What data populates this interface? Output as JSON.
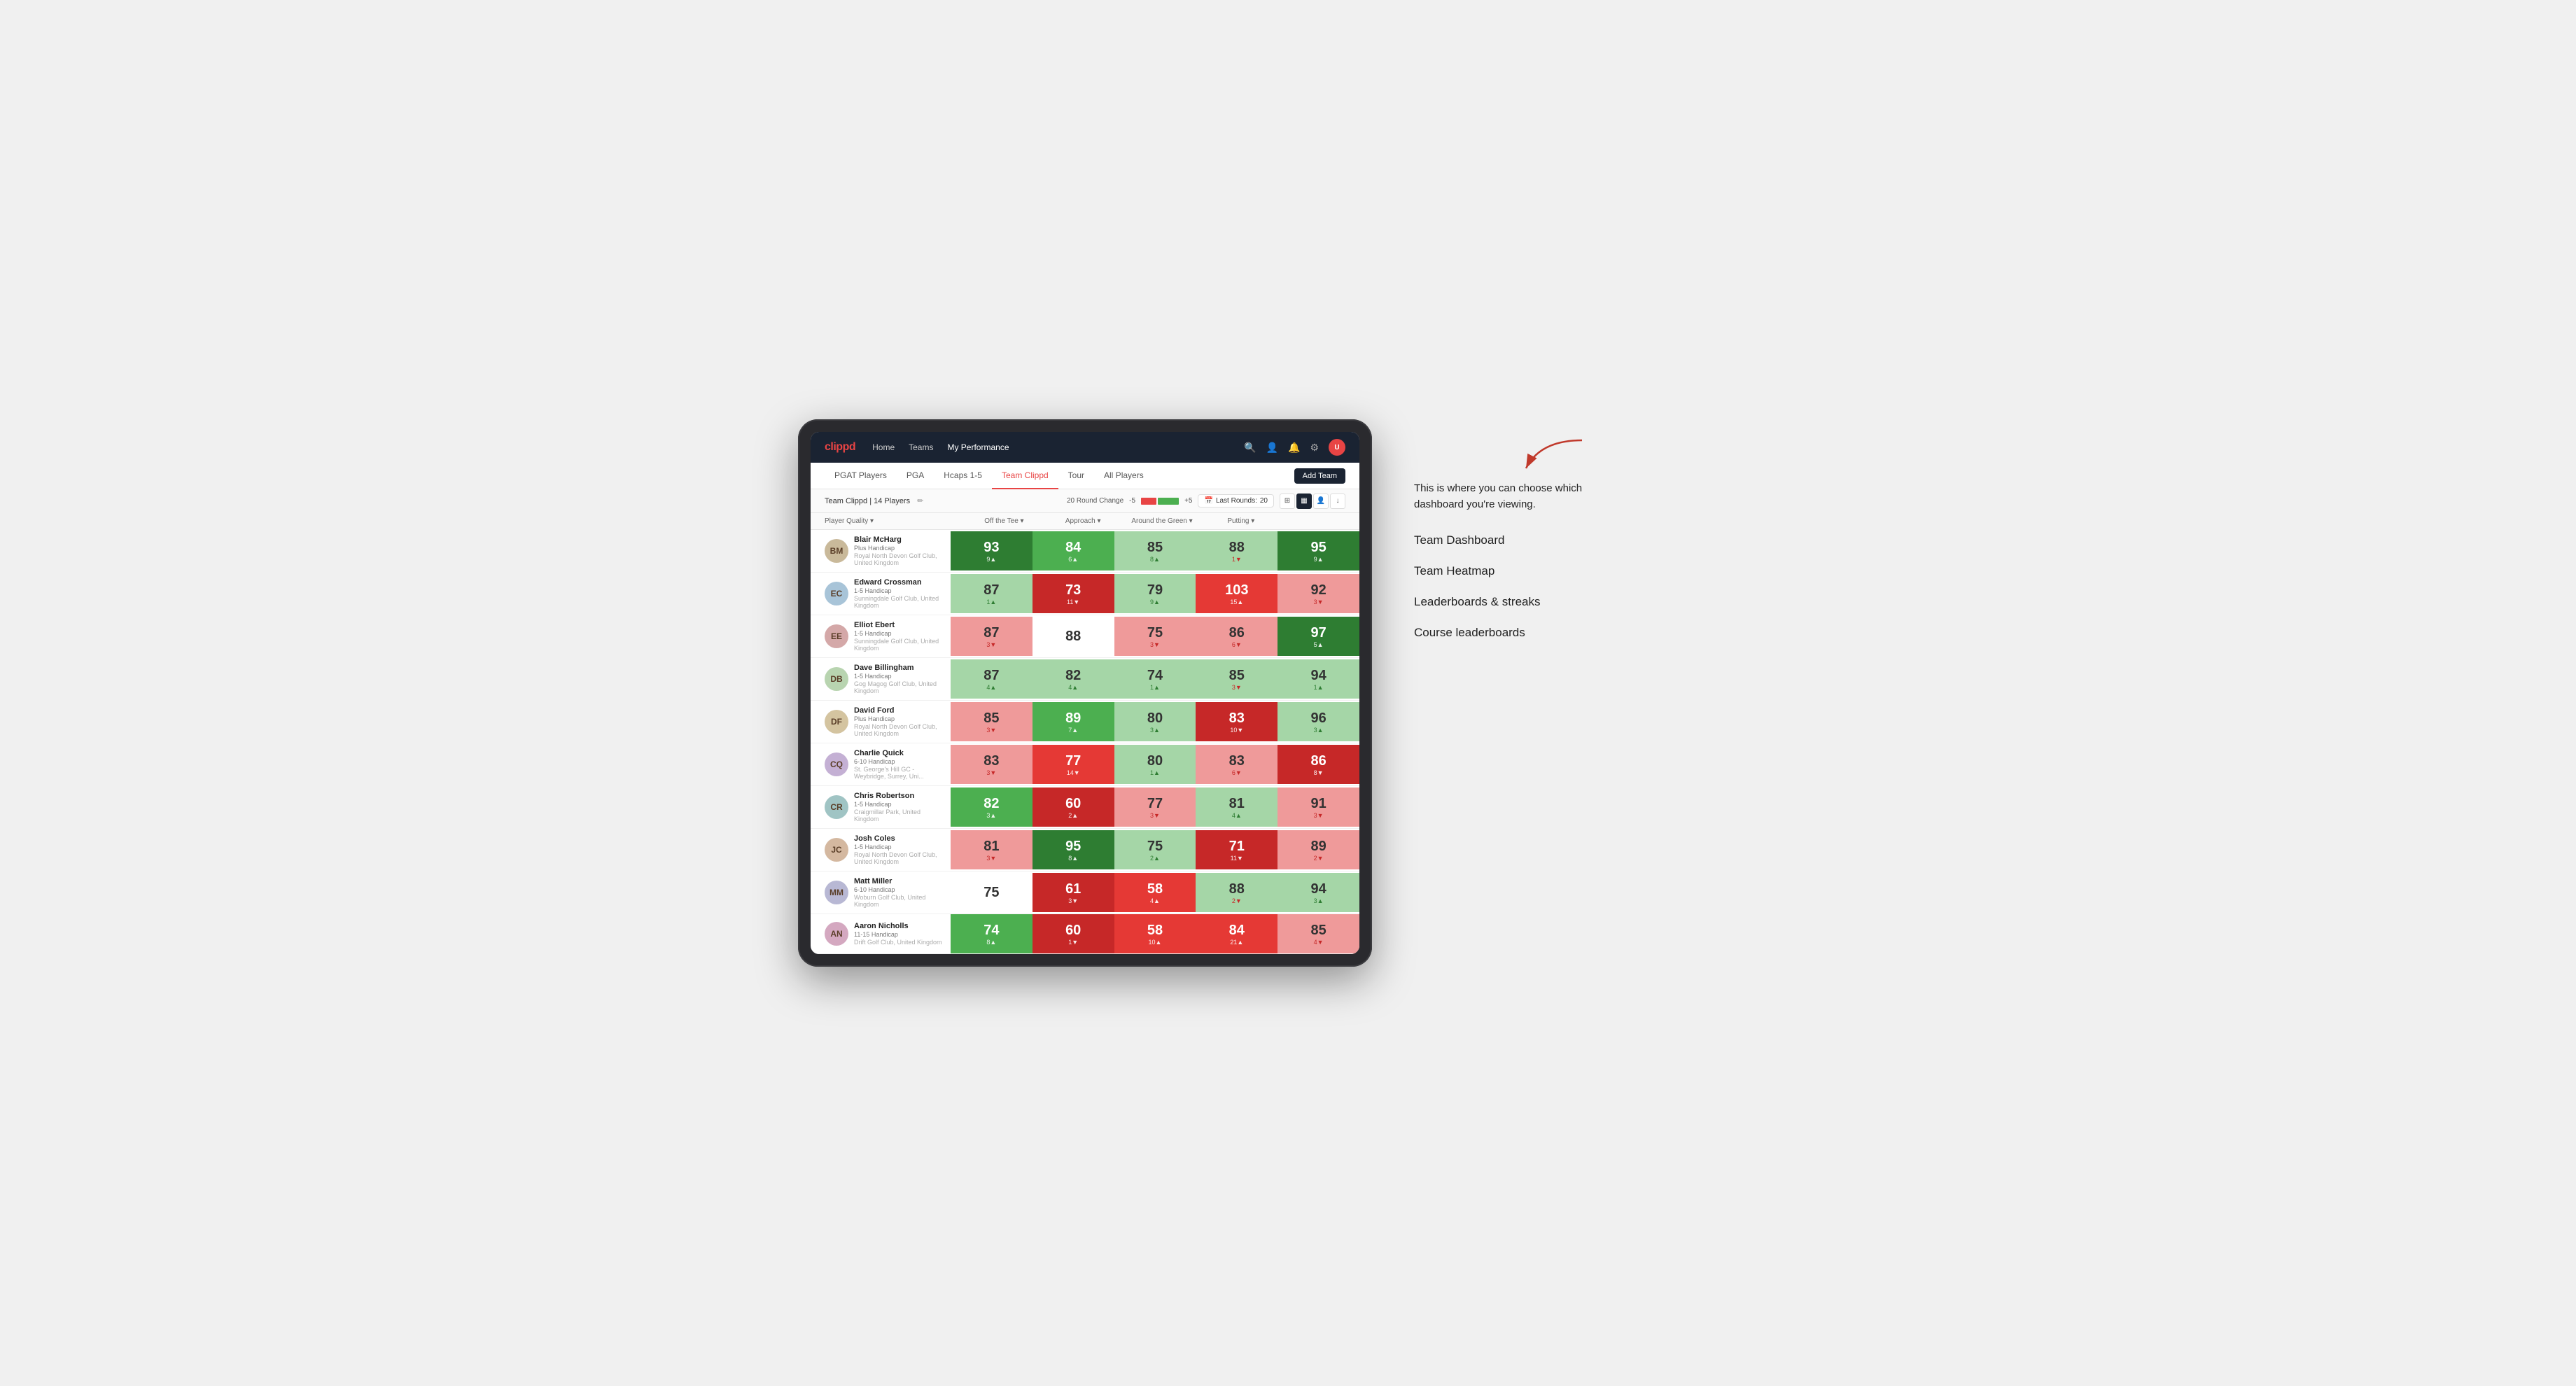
{
  "annotation": {
    "description": "This is where you can choose which dashboard you're viewing.",
    "items": [
      "Team Dashboard",
      "Team Heatmap",
      "Leaderboards & streaks",
      "Course leaderboards"
    ]
  },
  "nav": {
    "logo": "clippd",
    "links": [
      "Home",
      "Teams",
      "My Performance"
    ],
    "active_link": "My Performance"
  },
  "sub_nav": {
    "links": [
      "PGAT Players",
      "PGA",
      "Hcaps 1-5",
      "Team Clippd",
      "Tour",
      "All Players"
    ],
    "active_link": "Team Clippd",
    "add_team_label": "Add Team"
  },
  "team_header": {
    "name": "Team Clippd",
    "player_count": "14 Players",
    "round_change_label": "20 Round Change",
    "neg_label": "-5",
    "pos_label": "+5",
    "last_rounds_label": "Last Rounds:",
    "last_rounds_value": "20"
  },
  "table": {
    "columns": [
      "Player Quality ▾",
      "Off the Tee ▾",
      "Approach ▾",
      "Around the Green ▾",
      "Putting ▾"
    ],
    "players": [
      {
        "name": "Blair McHarg",
        "handicap": "Plus Handicap",
        "club": "Royal North Devon Golf Club, United Kingdom",
        "initials": "BM",
        "scores": [
          {
            "value": "93",
            "delta": "9▲",
            "bg": "bg-green-strong",
            "white": true
          },
          {
            "value": "84",
            "delta": "6▲",
            "bg": "bg-green-mid",
            "white": true
          },
          {
            "value": "85",
            "delta": "8▲",
            "bg": "bg-green-light",
            "white": false
          },
          {
            "value": "88",
            "delta": "1▼",
            "bg": "bg-green-light",
            "white": false
          },
          {
            "value": "95",
            "delta": "9▲",
            "bg": "bg-green-strong",
            "white": true
          }
        ]
      },
      {
        "name": "Edward Crossman",
        "handicap": "1-5 Handicap",
        "club": "Sunningdale Golf Club, United Kingdom",
        "initials": "EC",
        "scores": [
          {
            "value": "87",
            "delta": "1▲",
            "bg": "bg-green-light",
            "white": false
          },
          {
            "value": "73",
            "delta": "11▼",
            "bg": "bg-red-strong",
            "white": true
          },
          {
            "value": "79",
            "delta": "9▲",
            "bg": "bg-green-light",
            "white": false
          },
          {
            "value": "103",
            "delta": "15▲",
            "bg": "bg-red-mid",
            "white": true
          },
          {
            "value": "92",
            "delta": "3▼",
            "bg": "bg-red-light",
            "white": false
          }
        ]
      },
      {
        "name": "Elliot Ebert",
        "handicap": "1-5 Handicap",
        "club": "Sunningdale Golf Club, United Kingdom",
        "initials": "EE",
        "scores": [
          {
            "value": "87",
            "delta": "3▼",
            "bg": "bg-red-light",
            "white": false
          },
          {
            "value": "88",
            "delta": "",
            "bg": "bg-white",
            "white": false
          },
          {
            "value": "75",
            "delta": "3▼",
            "bg": "bg-red-light",
            "white": false
          },
          {
            "value": "86",
            "delta": "6▼",
            "bg": "bg-red-light",
            "white": false
          },
          {
            "value": "97",
            "delta": "5▲",
            "bg": "bg-green-strong",
            "white": true
          }
        ]
      },
      {
        "name": "Dave Billingham",
        "handicap": "1-5 Handicap",
        "club": "Gog Magog Golf Club, United Kingdom",
        "initials": "DB",
        "scores": [
          {
            "value": "87",
            "delta": "4▲",
            "bg": "bg-green-light",
            "white": false
          },
          {
            "value": "82",
            "delta": "4▲",
            "bg": "bg-green-light",
            "white": false
          },
          {
            "value": "74",
            "delta": "1▲",
            "bg": "bg-green-light",
            "white": false
          },
          {
            "value": "85",
            "delta": "3▼",
            "bg": "bg-green-light",
            "white": false
          },
          {
            "value": "94",
            "delta": "1▲",
            "bg": "bg-green-light",
            "white": false
          }
        ]
      },
      {
        "name": "David Ford",
        "handicap": "Plus Handicap",
        "club": "Royal North Devon Golf Club, United Kingdom",
        "initials": "DF",
        "scores": [
          {
            "value": "85",
            "delta": "3▼",
            "bg": "bg-red-light",
            "white": false
          },
          {
            "value": "89",
            "delta": "7▲",
            "bg": "bg-green-mid",
            "white": true
          },
          {
            "value": "80",
            "delta": "3▲",
            "bg": "bg-green-light",
            "white": false
          },
          {
            "value": "83",
            "delta": "10▼",
            "bg": "bg-red-strong",
            "white": true
          },
          {
            "value": "96",
            "delta": "3▲",
            "bg": "bg-green-light",
            "white": false
          }
        ]
      },
      {
        "name": "Charlie Quick",
        "handicap": "6-10 Handicap",
        "club": "St. George's Hill GC - Weybridge, Surrey, Uni...",
        "initials": "CQ",
        "scores": [
          {
            "value": "83",
            "delta": "3▼",
            "bg": "bg-red-light",
            "white": false
          },
          {
            "value": "77",
            "delta": "14▼",
            "bg": "bg-red-mid",
            "white": true
          },
          {
            "value": "80",
            "delta": "1▲",
            "bg": "bg-green-light",
            "white": false
          },
          {
            "value": "83",
            "delta": "6▼",
            "bg": "bg-red-light",
            "white": false
          },
          {
            "value": "86",
            "delta": "8▼",
            "bg": "bg-red-strong",
            "white": true
          }
        ]
      },
      {
        "name": "Chris Robertson",
        "handicap": "1-5 Handicap",
        "club": "Craigmillar Park, United Kingdom",
        "initials": "CR",
        "scores": [
          {
            "value": "82",
            "delta": "3▲",
            "bg": "bg-green-mid",
            "white": true
          },
          {
            "value": "60",
            "delta": "2▲",
            "bg": "bg-red-strong",
            "white": true
          },
          {
            "value": "77",
            "delta": "3▼",
            "bg": "bg-red-light",
            "white": false
          },
          {
            "value": "81",
            "delta": "4▲",
            "bg": "bg-green-light",
            "white": false
          },
          {
            "value": "91",
            "delta": "3▼",
            "bg": "bg-red-light",
            "white": false
          }
        ]
      },
      {
        "name": "Josh Coles",
        "handicap": "1-5 Handicap",
        "club": "Royal North Devon Golf Club, United Kingdom",
        "initials": "JC",
        "scores": [
          {
            "value": "81",
            "delta": "3▼",
            "bg": "bg-red-light",
            "white": false
          },
          {
            "value": "95",
            "delta": "8▲",
            "bg": "bg-green-strong",
            "white": true
          },
          {
            "value": "75",
            "delta": "2▲",
            "bg": "bg-green-light",
            "white": false
          },
          {
            "value": "71",
            "delta": "11▼",
            "bg": "bg-red-strong",
            "white": true
          },
          {
            "value": "89",
            "delta": "2▼",
            "bg": "bg-red-light",
            "white": false
          }
        ]
      },
      {
        "name": "Matt Miller",
        "handicap": "6-10 Handicap",
        "club": "Woburn Golf Club, United Kingdom",
        "initials": "MM",
        "scores": [
          {
            "value": "75",
            "delta": "",
            "bg": "bg-white",
            "white": false
          },
          {
            "value": "61",
            "delta": "3▼",
            "bg": "bg-red-strong",
            "white": true
          },
          {
            "value": "58",
            "delta": "4▲",
            "bg": "bg-red-mid",
            "white": true
          },
          {
            "value": "88",
            "delta": "2▼",
            "bg": "bg-green-light",
            "white": false
          },
          {
            "value": "94",
            "delta": "3▲",
            "bg": "bg-green-light",
            "white": false
          }
        ]
      },
      {
        "name": "Aaron Nicholls",
        "handicap": "11-15 Handicap",
        "club": "Drift Golf Club, United Kingdom",
        "initials": "AN",
        "scores": [
          {
            "value": "74",
            "delta": "8▲",
            "bg": "bg-green-mid",
            "white": true
          },
          {
            "value": "60",
            "delta": "1▼",
            "bg": "bg-red-strong",
            "white": true
          },
          {
            "value": "58",
            "delta": "10▲",
            "bg": "bg-red-mid",
            "white": true
          },
          {
            "value": "84",
            "delta": "21▲",
            "bg": "bg-red-mid",
            "white": true
          },
          {
            "value": "85",
            "delta": "4▼",
            "bg": "bg-red-light",
            "white": false
          }
        ]
      }
    ]
  }
}
